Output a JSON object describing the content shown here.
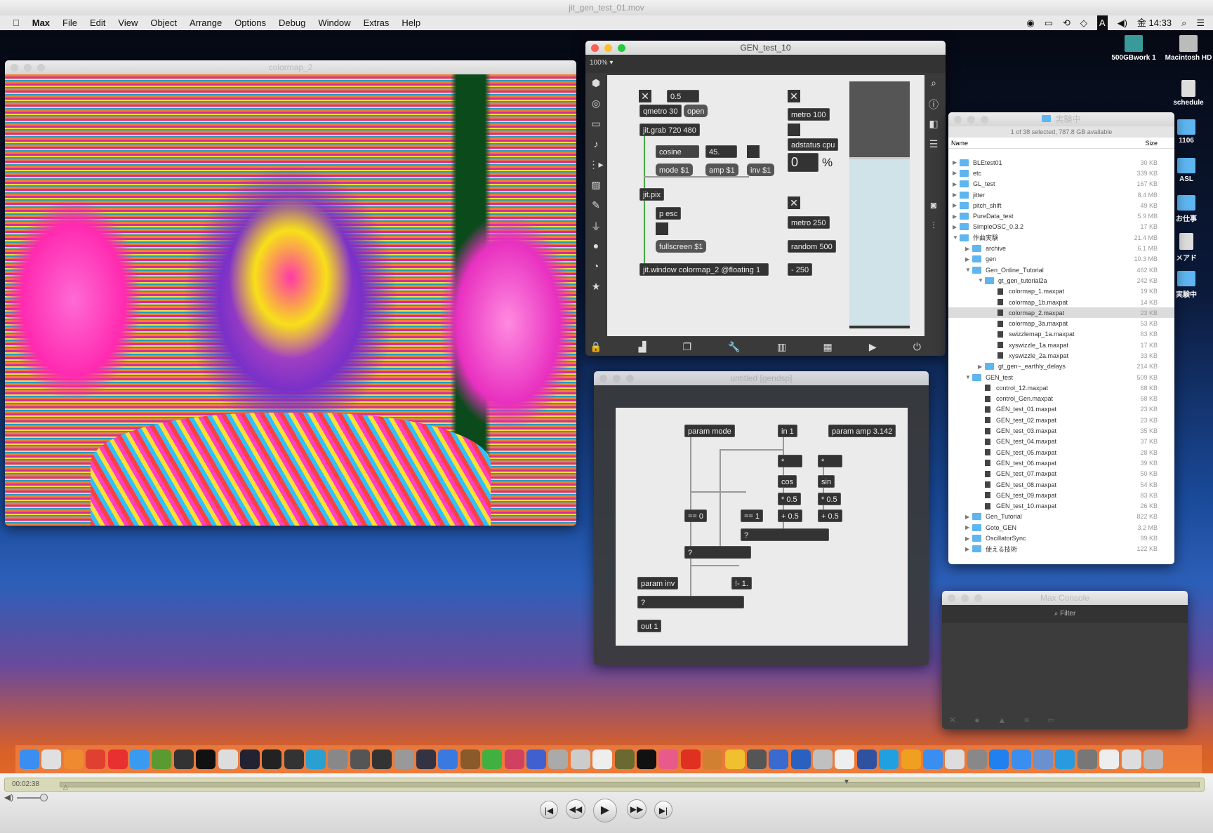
{
  "movie_title": "jit_gen_test_01.mov",
  "menubar": {
    "apple": "",
    "app": "Max",
    "items": [
      "File",
      "Edit",
      "View",
      "Object",
      "Arrange",
      "Options",
      "Debug",
      "Window",
      "Extras",
      "Help"
    ],
    "clock": "金 14:33",
    "input_badge": "A"
  },
  "desktop_icons": [
    "500GBwork 1",
    "Macintosh HD",
    "schedule",
    "1106",
    "ASL",
    "お仕事",
    "メアド",
    "実験中"
  ],
  "colormap_window": {
    "title": "colormap_2"
  },
  "gen_test_window": {
    "title": "GEN_test_10",
    "zoom": "100%",
    "objects": {
      "float": "0.5",
      "qmetro": "qmetro 30",
      "open": "open",
      "grab": "jit.grab 720 480",
      "cosine": "cosine",
      "angle": "45.",
      "mode": "mode $1",
      "amp": "amp $1",
      "inv": "inv $1",
      "pix": "jit.pix",
      "pesc": "p esc",
      "fullscreen": "fullscreen $1",
      "window": "jit.window colormap_2 @floating 1",
      "metro100": "metro 100",
      "adstatus": "adstatus cpu",
      "cpu": "0",
      "percent": "%",
      "metro250": "metro 250",
      "random": "random 500",
      "minus": "- 250"
    },
    "toggle": "✕",
    "meter_level": 0.68
  },
  "gen_window": {
    "title": "untitled [gendsp]",
    "objects": {
      "param_mode": "param mode",
      "in1": "in 1",
      "param_amp": "param amp 3.142",
      "mul1": "*",
      "mul2": "*",
      "cos": "cos",
      "sin": "sin",
      "half1": "* 0.5",
      "half2": "* 0.5",
      "add1": "+ 0.5",
      "add2": "+ 0.5",
      "eq0": "== 0",
      "eq1": "== 1",
      "sel1": "?",
      "sel2": "?",
      "param_inv": "param inv",
      "rsub": "!- 1.",
      "sel3": "?",
      "out1": "out 1"
    }
  },
  "finder": {
    "title": "実験中",
    "status": "1 of 38 selected, 787.8 GB available",
    "col_name": "Name",
    "col_size": "Size",
    "rows": [
      {
        "name": "BLEtest01",
        "size": "30 KB",
        "level": 0,
        "type": "folder",
        "open": false
      },
      {
        "name": "etc",
        "size": "339 KB",
        "level": 0,
        "type": "folder",
        "open": false
      },
      {
        "name": "GL_test",
        "size": "167 KB",
        "level": 0,
        "type": "folder",
        "open": false
      },
      {
        "name": "jitter",
        "size": "8.4 MB",
        "level": 0,
        "type": "folder",
        "open": false
      },
      {
        "name": "pitch_shift",
        "size": "49 KB",
        "level": 0,
        "type": "folder",
        "open": false
      },
      {
        "name": "PureData_test",
        "size": "5.9 MB",
        "level": 0,
        "type": "folder",
        "open": false
      },
      {
        "name": "SimpleOSC_0.3.2",
        "size": "17 KB",
        "level": 0,
        "type": "folder",
        "open": false
      },
      {
        "name": "作曲実験",
        "size": "21.4 MB",
        "level": 0,
        "type": "folder",
        "open": true
      },
      {
        "name": "archive",
        "size": "6.1 MB",
        "level": 1,
        "type": "folder",
        "open": false
      },
      {
        "name": "gen",
        "size": "10.3 MB",
        "level": 1,
        "type": "folder",
        "open": false
      },
      {
        "name": "Gen_Online_Tutorial",
        "size": "462 KB",
        "level": 1,
        "type": "folder",
        "open": true
      },
      {
        "name": "gt_gen_tutorial2a",
        "size": "242 KB",
        "level": 2,
        "type": "folder",
        "open": true
      },
      {
        "name": "colormap_1.maxpat",
        "size": "19 KB",
        "level": 3,
        "type": "file"
      },
      {
        "name": "colormap_1b.maxpat",
        "size": "14 KB",
        "level": 3,
        "type": "file"
      },
      {
        "name": "colormap_2.maxpat",
        "size": "23 KB",
        "level": 3,
        "type": "file",
        "selected": true
      },
      {
        "name": "colormap_3a.maxpat",
        "size": "53 KB",
        "level": 3,
        "type": "file"
      },
      {
        "name": "swizzlemap_1a.maxpat",
        "size": "63 KB",
        "level": 3,
        "type": "file"
      },
      {
        "name": "xyswizzle_1a.maxpat",
        "size": "17 KB",
        "level": 3,
        "type": "file"
      },
      {
        "name": "xyswizzle_2a.maxpat",
        "size": "33 KB",
        "level": 3,
        "type": "file"
      },
      {
        "name": "gt_gen~_earthly_delays",
        "size": "214 KB",
        "level": 2,
        "type": "folder",
        "open": false
      },
      {
        "name": "GEN_test",
        "size": "509 KB",
        "level": 1,
        "type": "folder",
        "open": true
      },
      {
        "name": "control_12.maxpat",
        "size": "68 KB",
        "level": 2,
        "type": "file"
      },
      {
        "name": "control_Gen.maxpat",
        "size": "68 KB",
        "level": 2,
        "type": "file"
      },
      {
        "name": "GEN_test_01.maxpat",
        "size": "23 KB",
        "level": 2,
        "type": "file"
      },
      {
        "name": "GEN_test_02.maxpat",
        "size": "23 KB",
        "level": 2,
        "type": "file"
      },
      {
        "name": "GEN_test_03.maxpat",
        "size": "35 KB",
        "level": 2,
        "type": "file"
      },
      {
        "name": "GEN_test_04.maxpat",
        "size": "37 KB",
        "level": 2,
        "type": "file"
      },
      {
        "name": "GEN_test_05.maxpat",
        "size": "28 KB",
        "level": 2,
        "type": "file"
      },
      {
        "name": "GEN_test_06.maxpat",
        "size": "39 KB",
        "level": 2,
        "type": "file"
      },
      {
        "name": "GEN_test_07.maxpat",
        "size": "50 KB",
        "level": 2,
        "type": "file"
      },
      {
        "name": "GEN_test_08.maxpat",
        "size": "54 KB",
        "level": 2,
        "type": "file"
      },
      {
        "name": "GEN_test_09.maxpat",
        "size": "83 KB",
        "level": 2,
        "type": "file"
      },
      {
        "name": "GEN_test_10.maxpat",
        "size": "26 KB",
        "level": 2,
        "type": "file"
      },
      {
        "name": "Gen_Tutorial",
        "size": "822 KB",
        "level": 1,
        "type": "folder",
        "open": false
      },
      {
        "name": "Goto_GEN",
        "size": "3.2 MB",
        "level": 1,
        "type": "folder",
        "open": false
      },
      {
        "name": "OscillatorSync",
        "size": "99 KB",
        "level": 1,
        "type": "folder",
        "open": false
      },
      {
        "name": "使える技術",
        "size": "122 KB",
        "level": 1,
        "type": "folder",
        "open": false
      }
    ]
  },
  "console": {
    "title": "Max Console",
    "filter_placeholder": "Filter"
  },
  "dock_colors": [
    "#3a8ef0",
    "#e0e0e0",
    "#f08a30",
    "#e04030",
    "#e83030",
    "#3a9af0",
    "#5a9a30",
    "#333",
    "#111",
    "#ddd",
    "#223",
    "#222",
    "#333",
    "#2aa0d0",
    "#888",
    "#555",
    "#333",
    "#999",
    "#334",
    "#3a7ae0",
    "#8a5a2a",
    "#40b040",
    "#d04060",
    "#4060d0",
    "#aaa",
    "#ccc",
    "#eee",
    "#6a6a30",
    "#111",
    "#e85a8a",
    "#e03020",
    "#d08030",
    "#f0c030",
    "#555",
    "#3a6ad0",
    "#2a60c0",
    "#c0c0c0",
    "#eee",
    "#3050a0",
    "#20a0e0",
    "#f0a020",
    "#3a8ef0",
    "#ddd",
    "#888",
    "#2080f0",
    "#3a8ef0",
    "#6a90d0",
    "#2a9ae0",
    "#777",
    "#eee",
    "#ddd",
    "#bbb"
  ],
  "player": {
    "time": "00:02:38",
    "playhead": 0.003
  }
}
